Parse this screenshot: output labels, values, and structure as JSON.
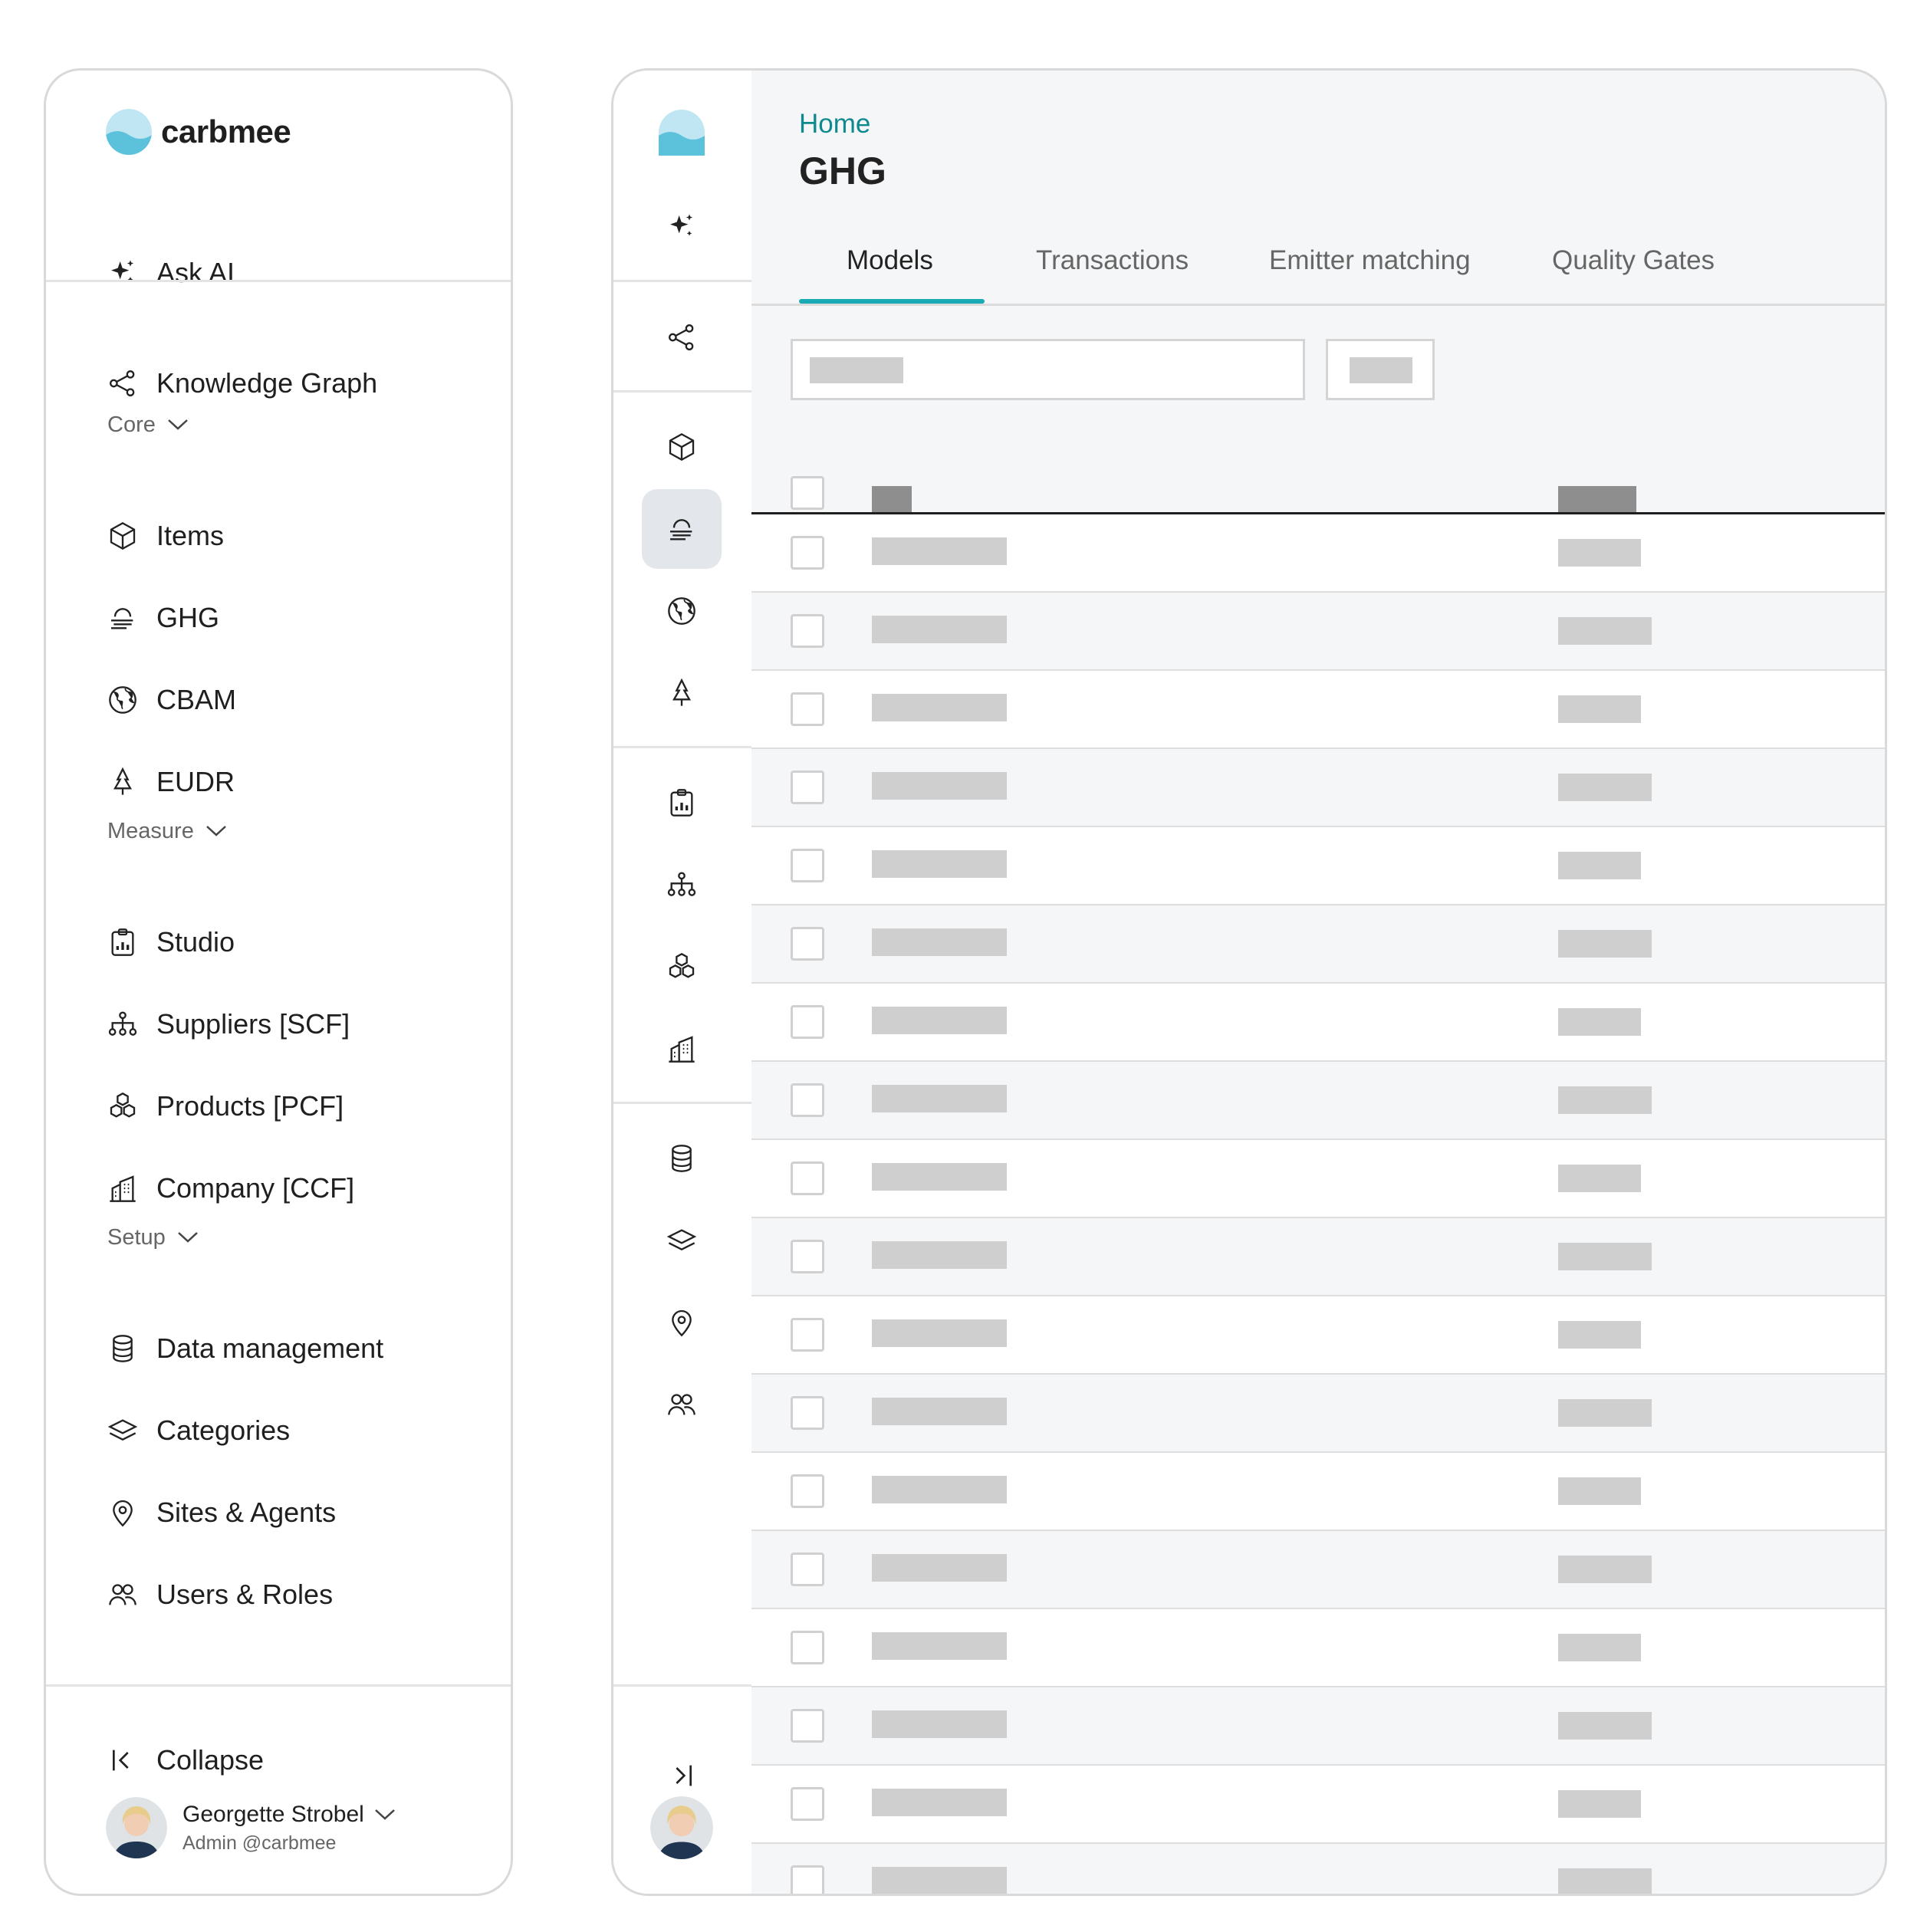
{
  "brand": {
    "name": "carbmee",
    "accent": "#19aab3",
    "link_color": "#0e8a8f"
  },
  "expanded_sidebar": {
    "ask_ai": "Ask AI",
    "knowledge_graph": "Knowledge Graph",
    "sections": {
      "core": {
        "label": "Core",
        "items": [
          {
            "label": "Items",
            "icon": "cube-icon"
          },
          {
            "label": "GHG",
            "icon": "cloud-wind-icon"
          },
          {
            "label": "CBAM",
            "icon": "globe-icon"
          },
          {
            "label": "EUDR",
            "icon": "tree-icon"
          }
        ]
      },
      "measure": {
        "label": "Measure",
        "items": [
          {
            "label": "Studio",
            "icon": "clipboard-chart-icon"
          },
          {
            "label": "Suppliers [SCF]",
            "icon": "hierarchy-icon"
          },
          {
            "label": "Products [PCF]",
            "icon": "boxes-icon"
          },
          {
            "label": "Company [CCF]",
            "icon": "building-icon"
          }
        ]
      },
      "setup": {
        "label": "Setup",
        "items": [
          {
            "label": "Data management",
            "icon": "database-icon"
          },
          {
            "label": "Categories",
            "icon": "layers-icon"
          },
          {
            "label": "Sites & Agents",
            "icon": "location-pin-icon"
          },
          {
            "label": "Users & Roles",
            "icon": "users-icon"
          }
        ]
      }
    },
    "collapse": "Collapse",
    "user": {
      "name": "Georgette Strobel",
      "role": "Admin @carbmee"
    }
  },
  "main": {
    "breadcrumb": "Home",
    "title": "GHG",
    "tabs": [
      {
        "label": "Models",
        "active": true
      },
      {
        "label": "Transactions",
        "active": false
      },
      {
        "label": "Emitter matching",
        "active": false
      },
      {
        "label": "Quality Gates",
        "active": false
      }
    ],
    "table": {
      "row_count": 18
    }
  }
}
